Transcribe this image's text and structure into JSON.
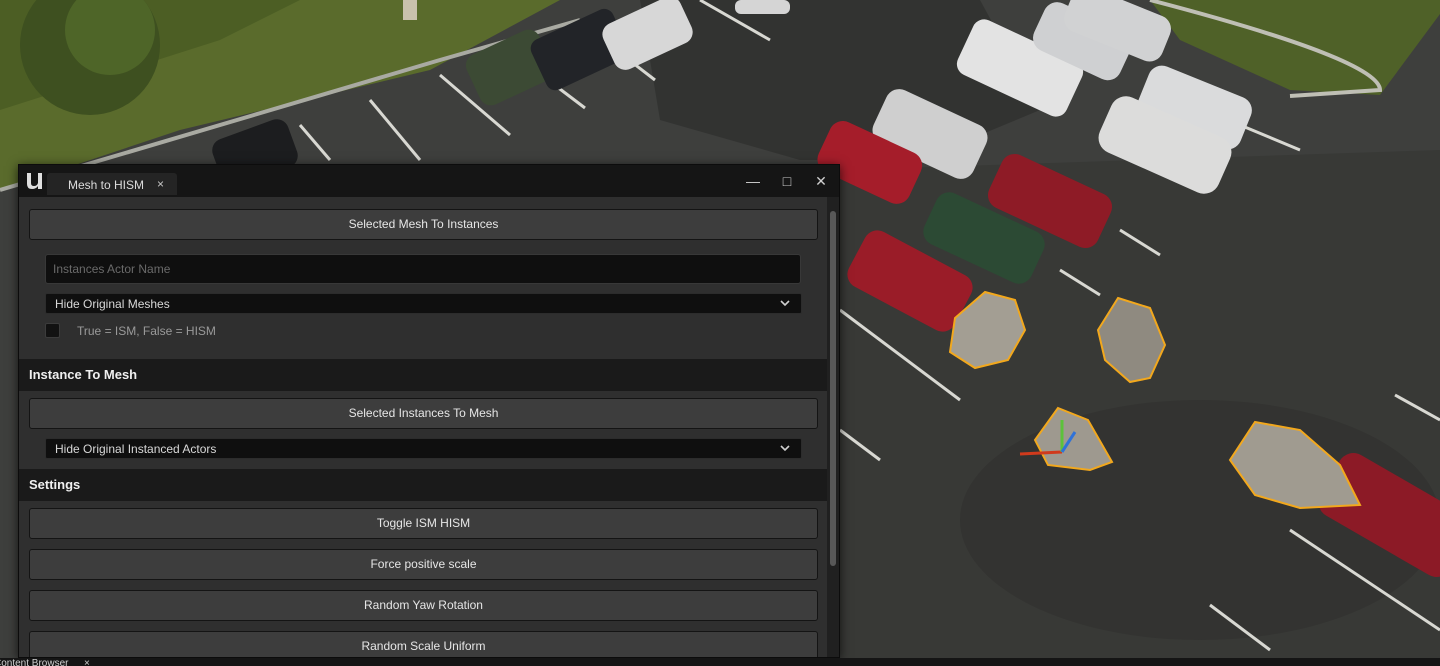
{
  "window": {
    "tab_title": "Mesh to HISM",
    "tab_close": "×",
    "minimize": "—",
    "maximize": "□",
    "close": "✕"
  },
  "mesh_to_instances": {
    "button": "Selected Mesh To Instances",
    "name_placeholder": "Instances Actor Name",
    "dropdown_value": "Hide Original Meshes",
    "checkbox_label": "True = ISM, False = HISM",
    "checkbox_checked": false
  },
  "instance_to_mesh": {
    "header": "Instance To Mesh",
    "button": "Selected Instances To Mesh",
    "dropdown_value": "Hide Original Instanced Actors"
  },
  "settings": {
    "header": "Settings",
    "buttons": [
      "Toggle ISM HISM",
      "Force positive scale",
      "Random Yaw Rotation",
      "Random Scale Uniform"
    ]
  },
  "bottom_bar": {
    "content_browser_tab": "Content Browser",
    "tab_close": "×"
  },
  "colors": {
    "panel_bg": "#2f2f2f",
    "header_bg": "#1a1a1a",
    "button_bg": "#3d3d3d",
    "selection_outline": "#f2a81d"
  }
}
